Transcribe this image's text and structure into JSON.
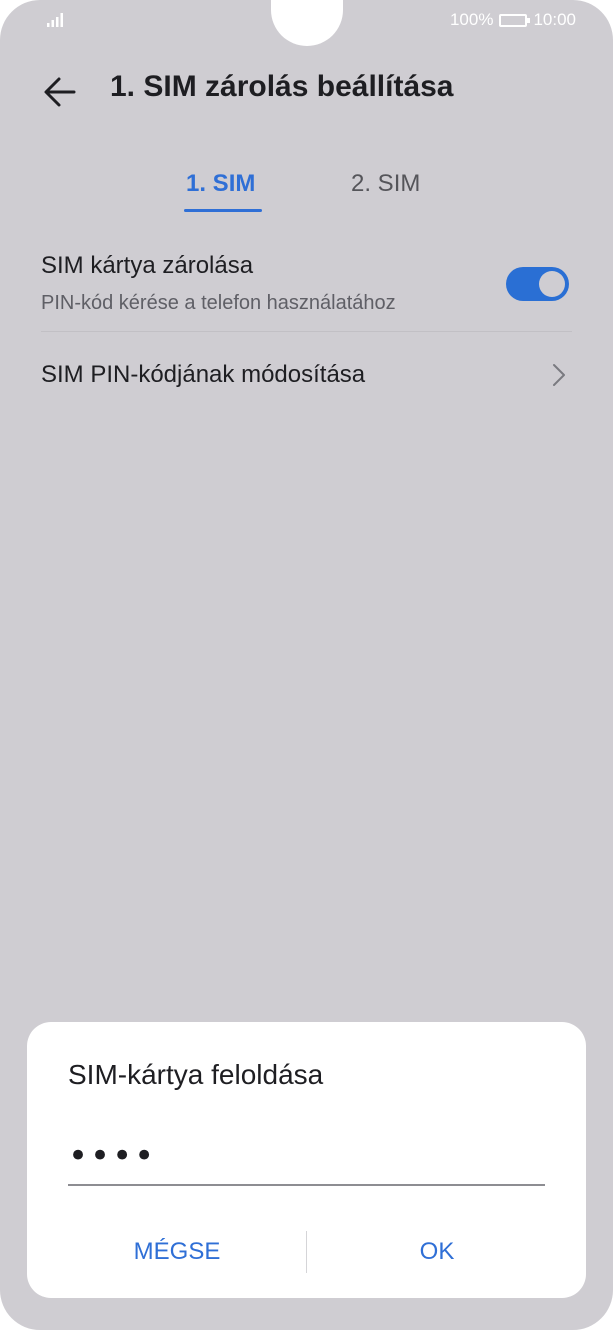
{
  "status_bar": {
    "battery_percent": "100%",
    "time": "10:00"
  },
  "header": {
    "title": "1. SIM zárolás beállítása"
  },
  "tabs": [
    {
      "label": "1. SIM",
      "active": true
    },
    {
      "label": "2. SIM",
      "active": false
    }
  ],
  "settings": {
    "sim_lock": {
      "title": "SIM kártya zárolása",
      "subtitle": "PIN-kód kérése a telefon használatához",
      "enabled": true
    },
    "change_pin": {
      "title": "SIM PIN-kódjának módosítása"
    }
  },
  "dialog": {
    "title": "SIM-kártya feloldása",
    "pin_value": "••••",
    "cancel_label": "MÉGSE",
    "ok_label": "OK"
  },
  "colors": {
    "accent": "#2f6fd6",
    "background": "#cfcdd2",
    "dialog_background": "#ffffff"
  }
}
